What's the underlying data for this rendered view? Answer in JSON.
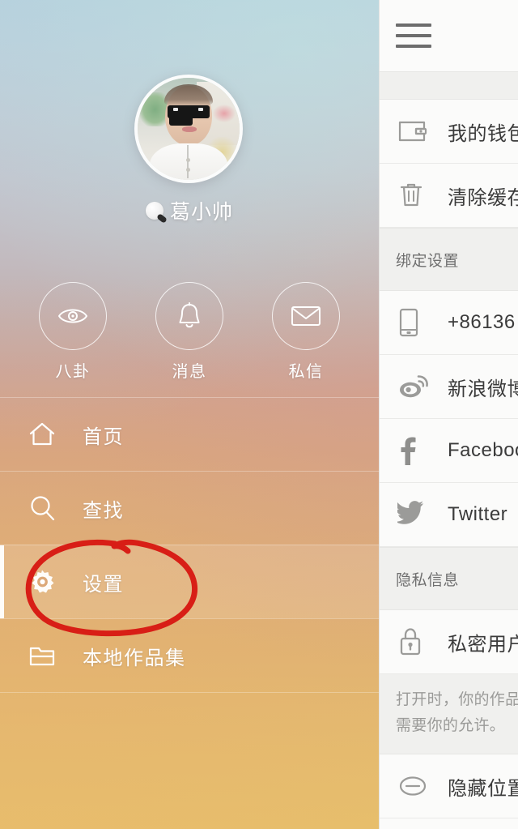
{
  "profile": {
    "avatar_name": "user-avatar",
    "username": "葛小帅",
    "badge_icon": "verified-badge-icon"
  },
  "quick_actions": [
    {
      "label": "八卦",
      "icon": "eye-icon"
    },
    {
      "label": "消息",
      "icon": "bell-icon"
    },
    {
      "label": "私信",
      "icon": "envelope-icon"
    }
  ],
  "nav": {
    "items": [
      {
        "label": "首页",
        "icon": "home-icon",
        "selected": false
      },
      {
        "label": "查找",
        "icon": "search-icon",
        "selected": false
      },
      {
        "label": "设置",
        "icon": "gear-icon",
        "selected": true
      },
      {
        "label": "本地作品集",
        "icon": "folder-icon",
        "selected": false
      }
    ]
  },
  "annotation": {
    "shape": "hand-drawn-ellipse",
    "color": "#d81e16",
    "targets": "设置"
  },
  "panel": {
    "menu_icon": "hamburger-icon",
    "rows": [
      {
        "type": "spacer"
      },
      {
        "type": "item",
        "label": "我的钱包",
        "icon": "wallet-icon"
      },
      {
        "type": "item",
        "label": "清除缓存",
        "icon": "trash-icon"
      },
      {
        "type": "header",
        "label": "绑定设置"
      },
      {
        "type": "item",
        "label": "+86136",
        "icon": "phone-icon"
      },
      {
        "type": "item",
        "label": "新浪微博",
        "icon": "weibo-icon"
      },
      {
        "type": "item",
        "label": "Facebook",
        "icon": "facebook-icon"
      },
      {
        "type": "item",
        "label": "Twitter",
        "icon": "twitter-icon"
      },
      {
        "type": "header",
        "label": "隐私信息"
      },
      {
        "type": "item",
        "label": "私密用户",
        "icon": "lock-icon"
      },
      {
        "type": "note",
        "label": "打开时，你的作品\n需要你的允许。"
      },
      {
        "type": "item",
        "label": "隐藏位置",
        "icon": "circle-minus-icon"
      }
    ]
  },
  "colors": {
    "drawer_top": "#bcd3de",
    "drawer_bottom": "#e7be6c",
    "annotation_red": "#d81e16",
    "panel_bg": "#fbfbfa",
    "panel_section_bg": "#f0f0ee",
    "panel_text": "#3b3b3b",
    "panel_muted": "#9a9a98"
  }
}
